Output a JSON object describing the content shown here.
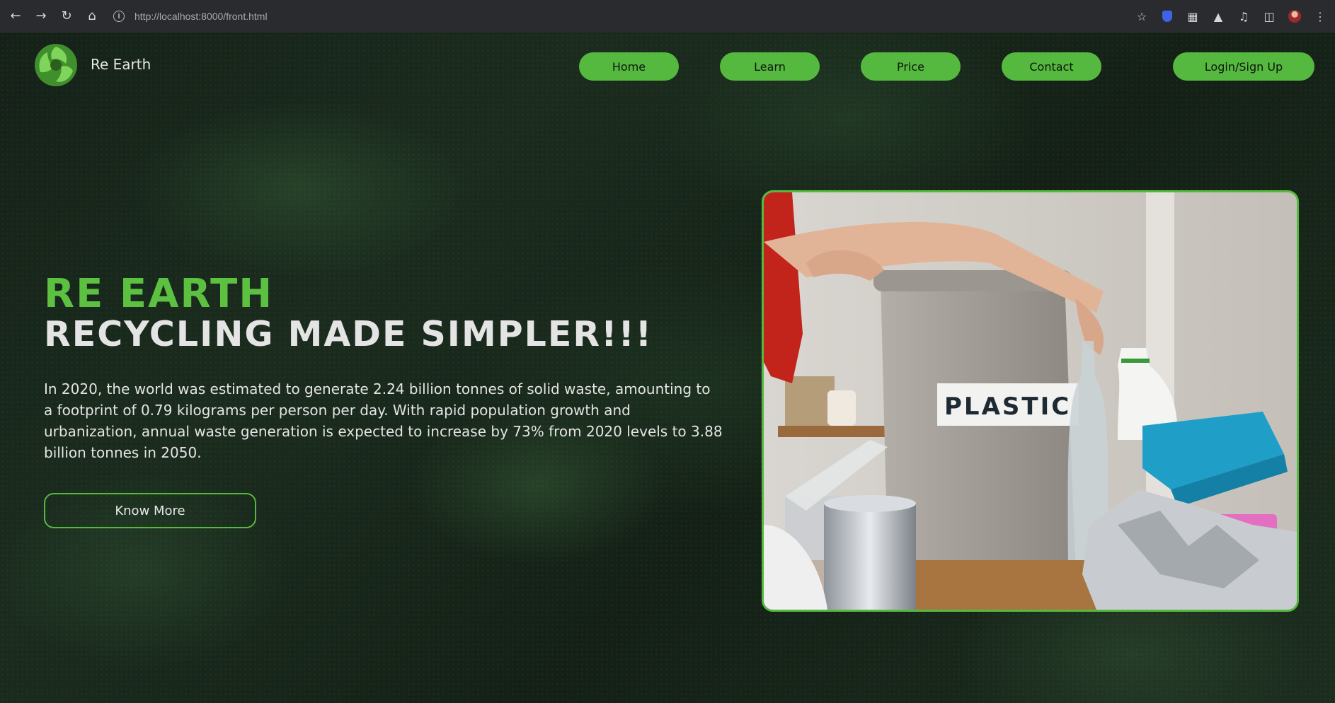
{
  "browser": {
    "url": "http://localhost:8000/front.html",
    "icons": [
      "back-icon",
      "forward-icon",
      "reload-icon",
      "home-icon",
      "info-icon",
      "bookmark-star-icon",
      "bitwarden-shield-icon",
      "extensions-icon",
      "labs-icon",
      "media-control-icon",
      "side-panel-icon",
      "profile-avatar",
      "menu-icon"
    ]
  },
  "header": {
    "brand": "Re Earth",
    "nav": [
      "Home",
      "Learn",
      "Price",
      "Contact"
    ],
    "login": "Login/Sign Up"
  },
  "hero": {
    "title": "RE EARTH",
    "subtitle": "RECYCLING MADE SIMPLER!!!",
    "paragraph": "In 2020, the world was estimated to generate 2.24 billion tonnes of solid waste, amounting to a footprint of 0.79 kilograms per person per day. With rapid population growth and urbanization, annual waste generation is expected to increase by 73% from 2020 levels to 3.88 billion tonnes in 2050.",
    "button": "Know More",
    "image_label": "PLASTIC"
  },
  "colors": {
    "accent": "#56b93f",
    "title_green": "#5cc141",
    "text": "#e4e4e4",
    "background": "#152118"
  }
}
